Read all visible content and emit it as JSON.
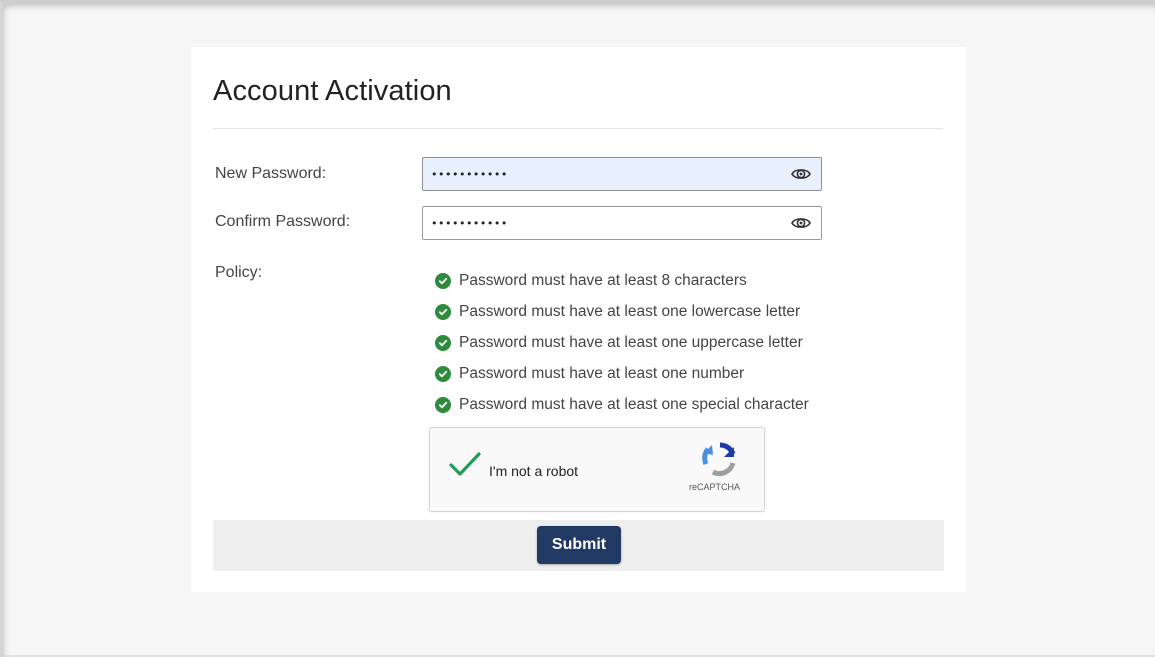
{
  "page": {
    "title": "Account Activation"
  },
  "form": {
    "new_password": {
      "label": "New Password:",
      "value": "•••••••••••",
      "type": "password",
      "toggle_icon": "eye-icon"
    },
    "confirm_password": {
      "label": "Confirm Password:",
      "value": "•••••••••••",
      "type": "password",
      "toggle_icon": "eye-icon"
    },
    "policy": {
      "label": "Policy:",
      "items": [
        {
          "text": "Password must have at least 8 characters",
          "status": "met"
        },
        {
          "text": "Password must have at least one lowercase letter",
          "status": "met"
        },
        {
          "text": "Password must have at least one uppercase letter",
          "status": "met"
        },
        {
          "text": "Password must have at least one number",
          "status": "met"
        },
        {
          "text": "Password must have at least one special character",
          "status": "met"
        }
      ]
    },
    "captcha": {
      "label": "I'm not a robot",
      "brand": "reCAPTCHA",
      "checked": true
    },
    "submit_label": "Submit"
  },
  "colors": {
    "accent": "#213a64",
    "success": "#2e8b3e",
    "captcha_check": "#1e9e55",
    "active_field_bg": "#e8f0fe"
  }
}
